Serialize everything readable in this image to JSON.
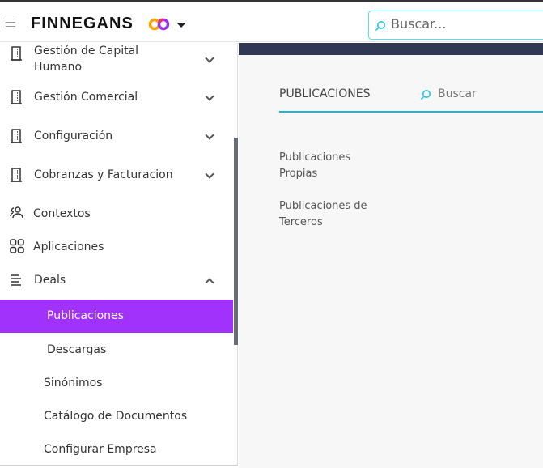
{
  "header": {
    "brand": "FINNEGANS",
    "search_placeholder": "Buscar..."
  },
  "sidebar": {
    "items": [
      {
        "label": "Gestión de Capital Humano",
        "icon": "building-icon"
      },
      {
        "label": "Gestión Comercial",
        "icon": "building-icon"
      },
      {
        "label": "Configuración",
        "icon": "building-icon"
      },
      {
        "label": "Cobranzas y Facturacion",
        "icon": "building-icon"
      },
      {
        "label": "Contextos",
        "icon": "users-icon"
      },
      {
        "label": "Aplicaciones",
        "icon": "grid-icon"
      },
      {
        "label": "Deals",
        "icon": "align-icon"
      }
    ],
    "subitems": [
      "Publicaciones",
      "Descargas"
    ],
    "extra": [
      "Sinónimos",
      "Catálogo de Documentos",
      "Configurar Empresa"
    ]
  },
  "main": {
    "title": "PUBLICACIONES",
    "search_placeholder": "Buscar",
    "links": [
      "Publicaciones Propias",
      "Publicaciones de Terceros"
    ]
  },
  "colors": {
    "accent": "#a032fb",
    "cyan": "#1ab8d0",
    "navy": "#313853"
  }
}
